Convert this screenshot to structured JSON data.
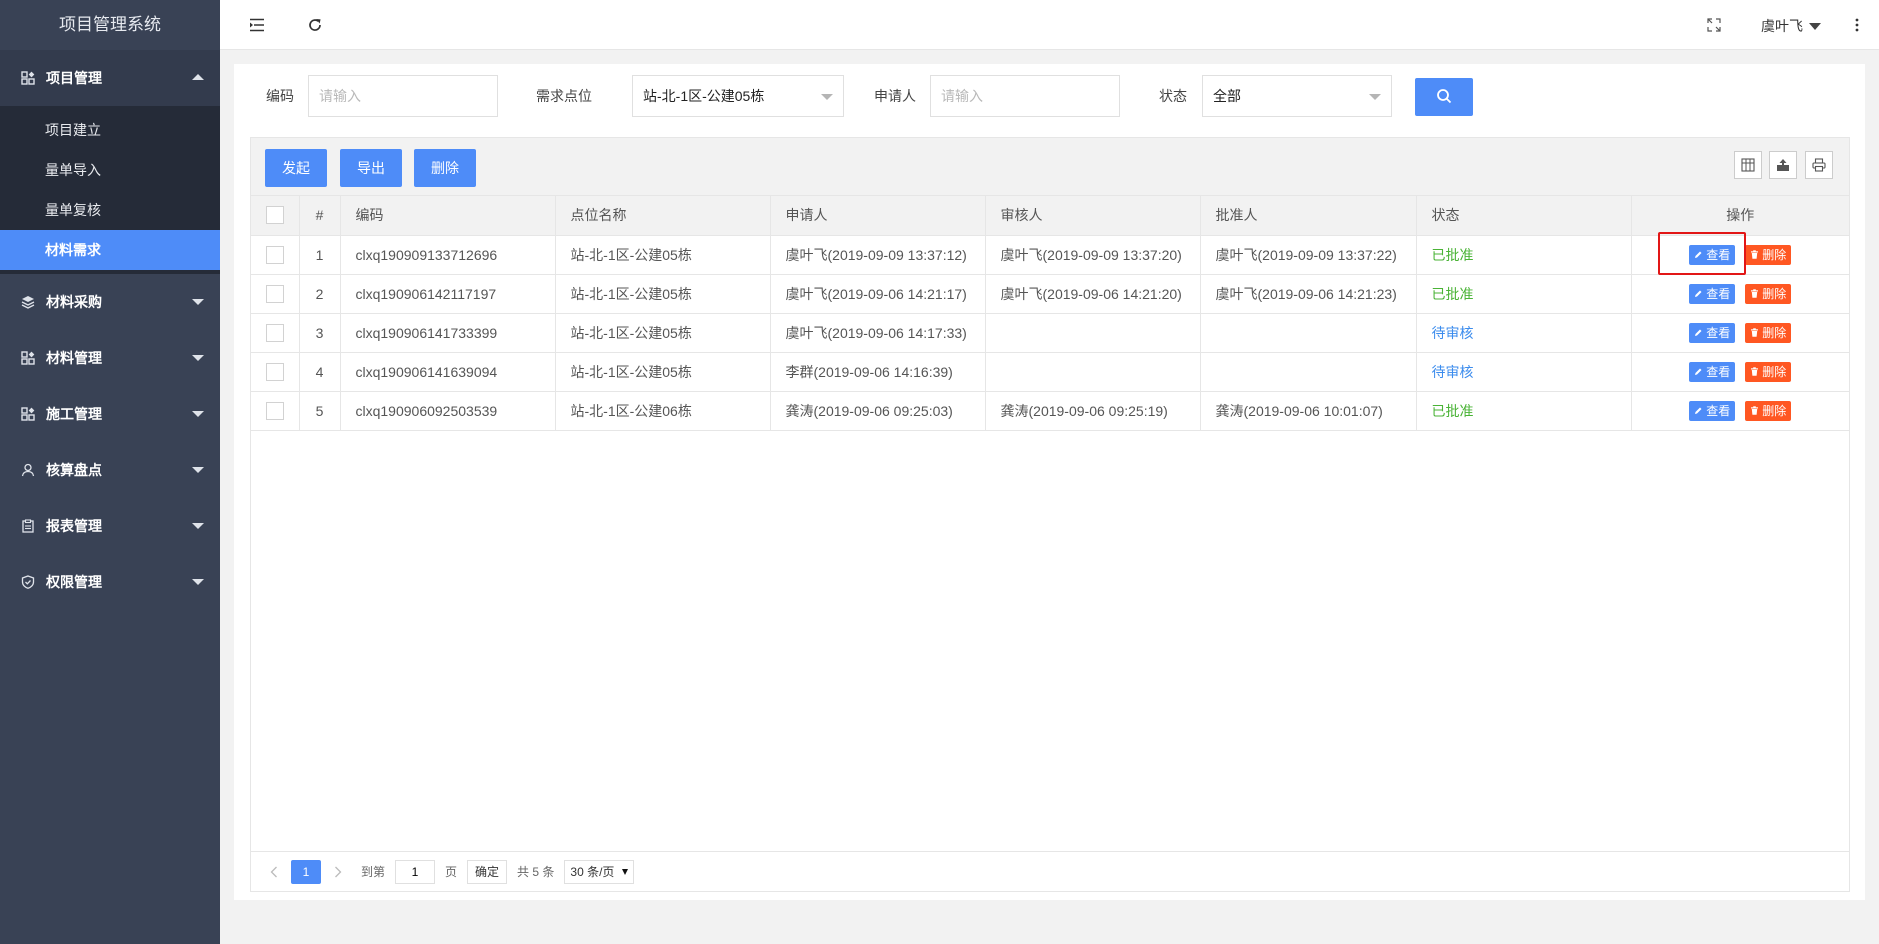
{
  "app": {
    "title": "项目管理系统"
  },
  "sidebar": {
    "groups": [
      {
        "label": "项目管理",
        "icon": "apps-icon",
        "expanded": true,
        "items": [
          {
            "label": "项目建立",
            "active": false
          },
          {
            "label": "量单导入",
            "active": false
          },
          {
            "label": "量单复核",
            "active": false
          },
          {
            "label": "材料需求",
            "active": true
          }
        ]
      },
      {
        "label": "材料采购",
        "icon": "layers-icon",
        "expanded": false
      },
      {
        "label": "材料管理",
        "icon": "apps-icon",
        "expanded": false
      },
      {
        "label": "施工管理",
        "icon": "apps-icon",
        "expanded": false
      },
      {
        "label": "核算盘点",
        "icon": "user-icon",
        "expanded": false
      },
      {
        "label": "报表管理",
        "icon": "clipboard-icon",
        "expanded": false
      },
      {
        "label": "权限管理",
        "icon": "shield-icon",
        "expanded": false
      }
    ]
  },
  "topbar": {
    "user": "虞叶飞"
  },
  "filters": {
    "code_label": "编码",
    "code_placeholder": "请输入",
    "site_label": "需求点位",
    "site_value": "站-北-1区-公建05栋",
    "applicant_label": "申请人",
    "applicant_placeholder": "请输入",
    "status_label": "状态",
    "status_value": "全部"
  },
  "toolbar": {
    "start": "发起",
    "export": "导出",
    "delete": "删除"
  },
  "table": {
    "headers": [
      "#",
      "编码",
      "点位名称",
      "申请人",
      "审核人",
      "批准人",
      "状态",
      "操作"
    ],
    "rows": [
      {
        "num": "1",
        "code": "clxq190909133712696",
        "site": "站-北-1区-公建05栋",
        "applicant": "虞叶飞(2019-09-09 13:37:12)",
        "reviewer": "虞叶飞(2019-09-09 13:37:20)",
        "approver": "虞叶飞(2019-09-09 13:37:22)",
        "status": "已批准",
        "status_type": "ok"
      },
      {
        "num": "2",
        "code": "clxq190906142117197",
        "site": "站-北-1区-公建05栋",
        "applicant": "虞叶飞(2019-09-06 14:21:17)",
        "reviewer": "虞叶飞(2019-09-06 14:21:20)",
        "approver": "虞叶飞(2019-09-06 14:21:23)",
        "status": "已批准",
        "status_type": "ok"
      },
      {
        "num": "3",
        "code": "clxq190906141733399",
        "site": "站-北-1区-公建05栋",
        "applicant": "虞叶飞(2019-09-06 14:17:33)",
        "reviewer": "",
        "approver": "",
        "status": "待审核",
        "status_type": "wait"
      },
      {
        "num": "4",
        "code": "clxq190906141639094",
        "site": "站-北-1区-公建05栋",
        "applicant": "李群(2019-09-06 14:16:39)",
        "reviewer": "",
        "approver": "",
        "status": "待审核",
        "status_type": "wait"
      },
      {
        "num": "5",
        "code": "clxq190906092503539",
        "site": "站-北-1区-公建06栋",
        "applicant": "龚涛(2019-09-06 09:25:03)",
        "reviewer": "龚涛(2019-09-06 09:25:19)",
        "approver": "龚涛(2019-09-06 10:01:07)",
        "status": "已批准",
        "status_type": "ok"
      }
    ],
    "actions": {
      "view": "查看",
      "delete": "删除"
    }
  },
  "pager": {
    "current": "1",
    "goto_label": "到第",
    "goto_value": "1",
    "page_unit": "页",
    "confirm": "确定",
    "total": "共 5 条",
    "page_size": "30 条/页"
  },
  "colors": {
    "primary": "#4e8cf8",
    "danger": "#ff5722",
    "approved": "#4ab336",
    "pending": "#3c8ced",
    "sidebar": "#394255",
    "highlight": "#e21616"
  }
}
